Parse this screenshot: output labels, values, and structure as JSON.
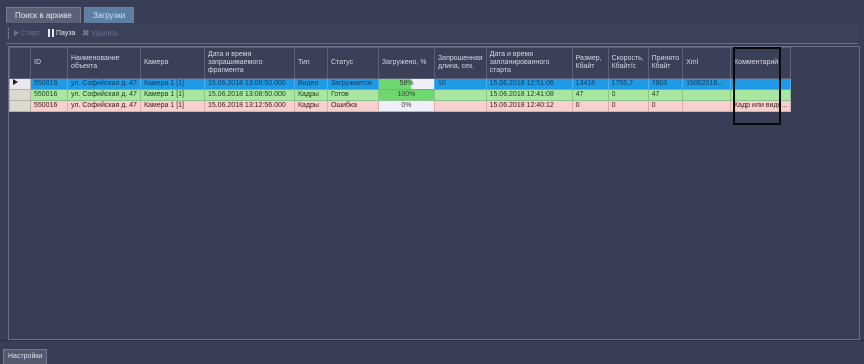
{
  "tabs": [
    {
      "label": "Поиск в архиве",
      "active": false
    },
    {
      "label": "Загрузки",
      "active": true
    }
  ],
  "toolbar": {
    "start_label": "Старт",
    "pause_label": "Пауза",
    "delete_label": "Удалить"
  },
  "table": {
    "columns": [
      "ID",
      "Наименование объекта",
      "Камера",
      "Дата и время запрашиваемого фрагмента",
      "Тип",
      "Статус",
      "Загружено, %",
      "Запрошенная длина, сек.",
      "Дата и время запланированного старта",
      "Размер, Кбайт",
      "Скорость, Кбайт/с",
      "Принято Кбайт",
      "Xml",
      "Комментарий"
    ],
    "rows": [
      {
        "id": "550016",
        "object": "ул. Софийская д. 47",
        "camera": "Камера 1 [1]",
        "fragment_time": "15.06.2018 13:08:50.000",
        "type": "Видео",
        "status": "Загружается",
        "progress": 58,
        "progress_text": "58%",
        "length": "10",
        "planned_start": "15.06.2018 12:51:06",
        "size": "13418",
        "speed": "1755,7",
        "received": "7803",
        "xml": "15062018...",
        "comment": ""
      },
      {
        "id": "550016",
        "object": "ул. Софийская д. 47",
        "camera": "Камера 1 [1]",
        "fragment_time": "15.06.2018 13:08:50.000",
        "type": "Кадры",
        "status": "Готов",
        "progress": 100,
        "progress_text": "100%",
        "length": "",
        "planned_start": "15.06.2018 12:41:08",
        "size": "47",
        "speed": "0",
        "received": "47",
        "xml": "",
        "comment": ""
      },
      {
        "id": "550016",
        "object": "ул. Софийская д. 47",
        "camera": "Камера 1 [1]",
        "fragment_time": "15.06.2018 13:12:56.000",
        "type": "Кадры",
        "status": "Ошибка",
        "progress": 0,
        "progress_text": "0%",
        "length": "",
        "planned_start": "15.06.2018 12:40:12",
        "size": "0",
        "speed": "0",
        "received": "0",
        "xml": "",
        "comment": "Кадр или виде..."
      }
    ]
  },
  "bottom_tab": {
    "label": "Настройки"
  }
}
